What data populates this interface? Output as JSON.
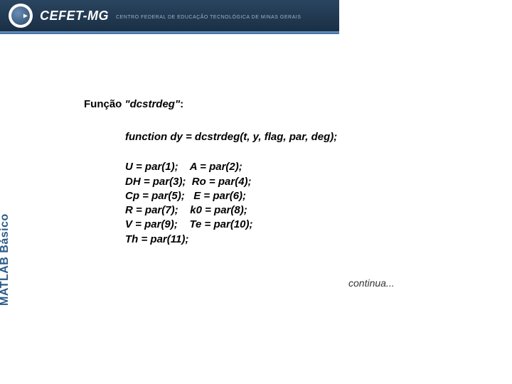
{
  "header": {
    "brand": "CEFET-MG",
    "subtitle": "CENTRO FEDERAL DE EDUCAÇÃO TECNOLÓGICA DE MINAS GERAIS"
  },
  "sidebar": {
    "label": "MATLAB Básico"
  },
  "content": {
    "title_prefix": "Função ",
    "title_fn": "\"dcstrdeg\"",
    "title_suffix": ":",
    "signature": "function dy = dcstrdeg(t, y, flag, par, deg);",
    "params": "U = par(1);    A = par(2);\nDH = par(3);  Ro = par(4);\nCp = par(5);   E = par(6);\nR = par(7);    k0 = par(8);\nV = par(9);    Te = par(10);\nTh = par(11);",
    "continua": "continua..."
  }
}
